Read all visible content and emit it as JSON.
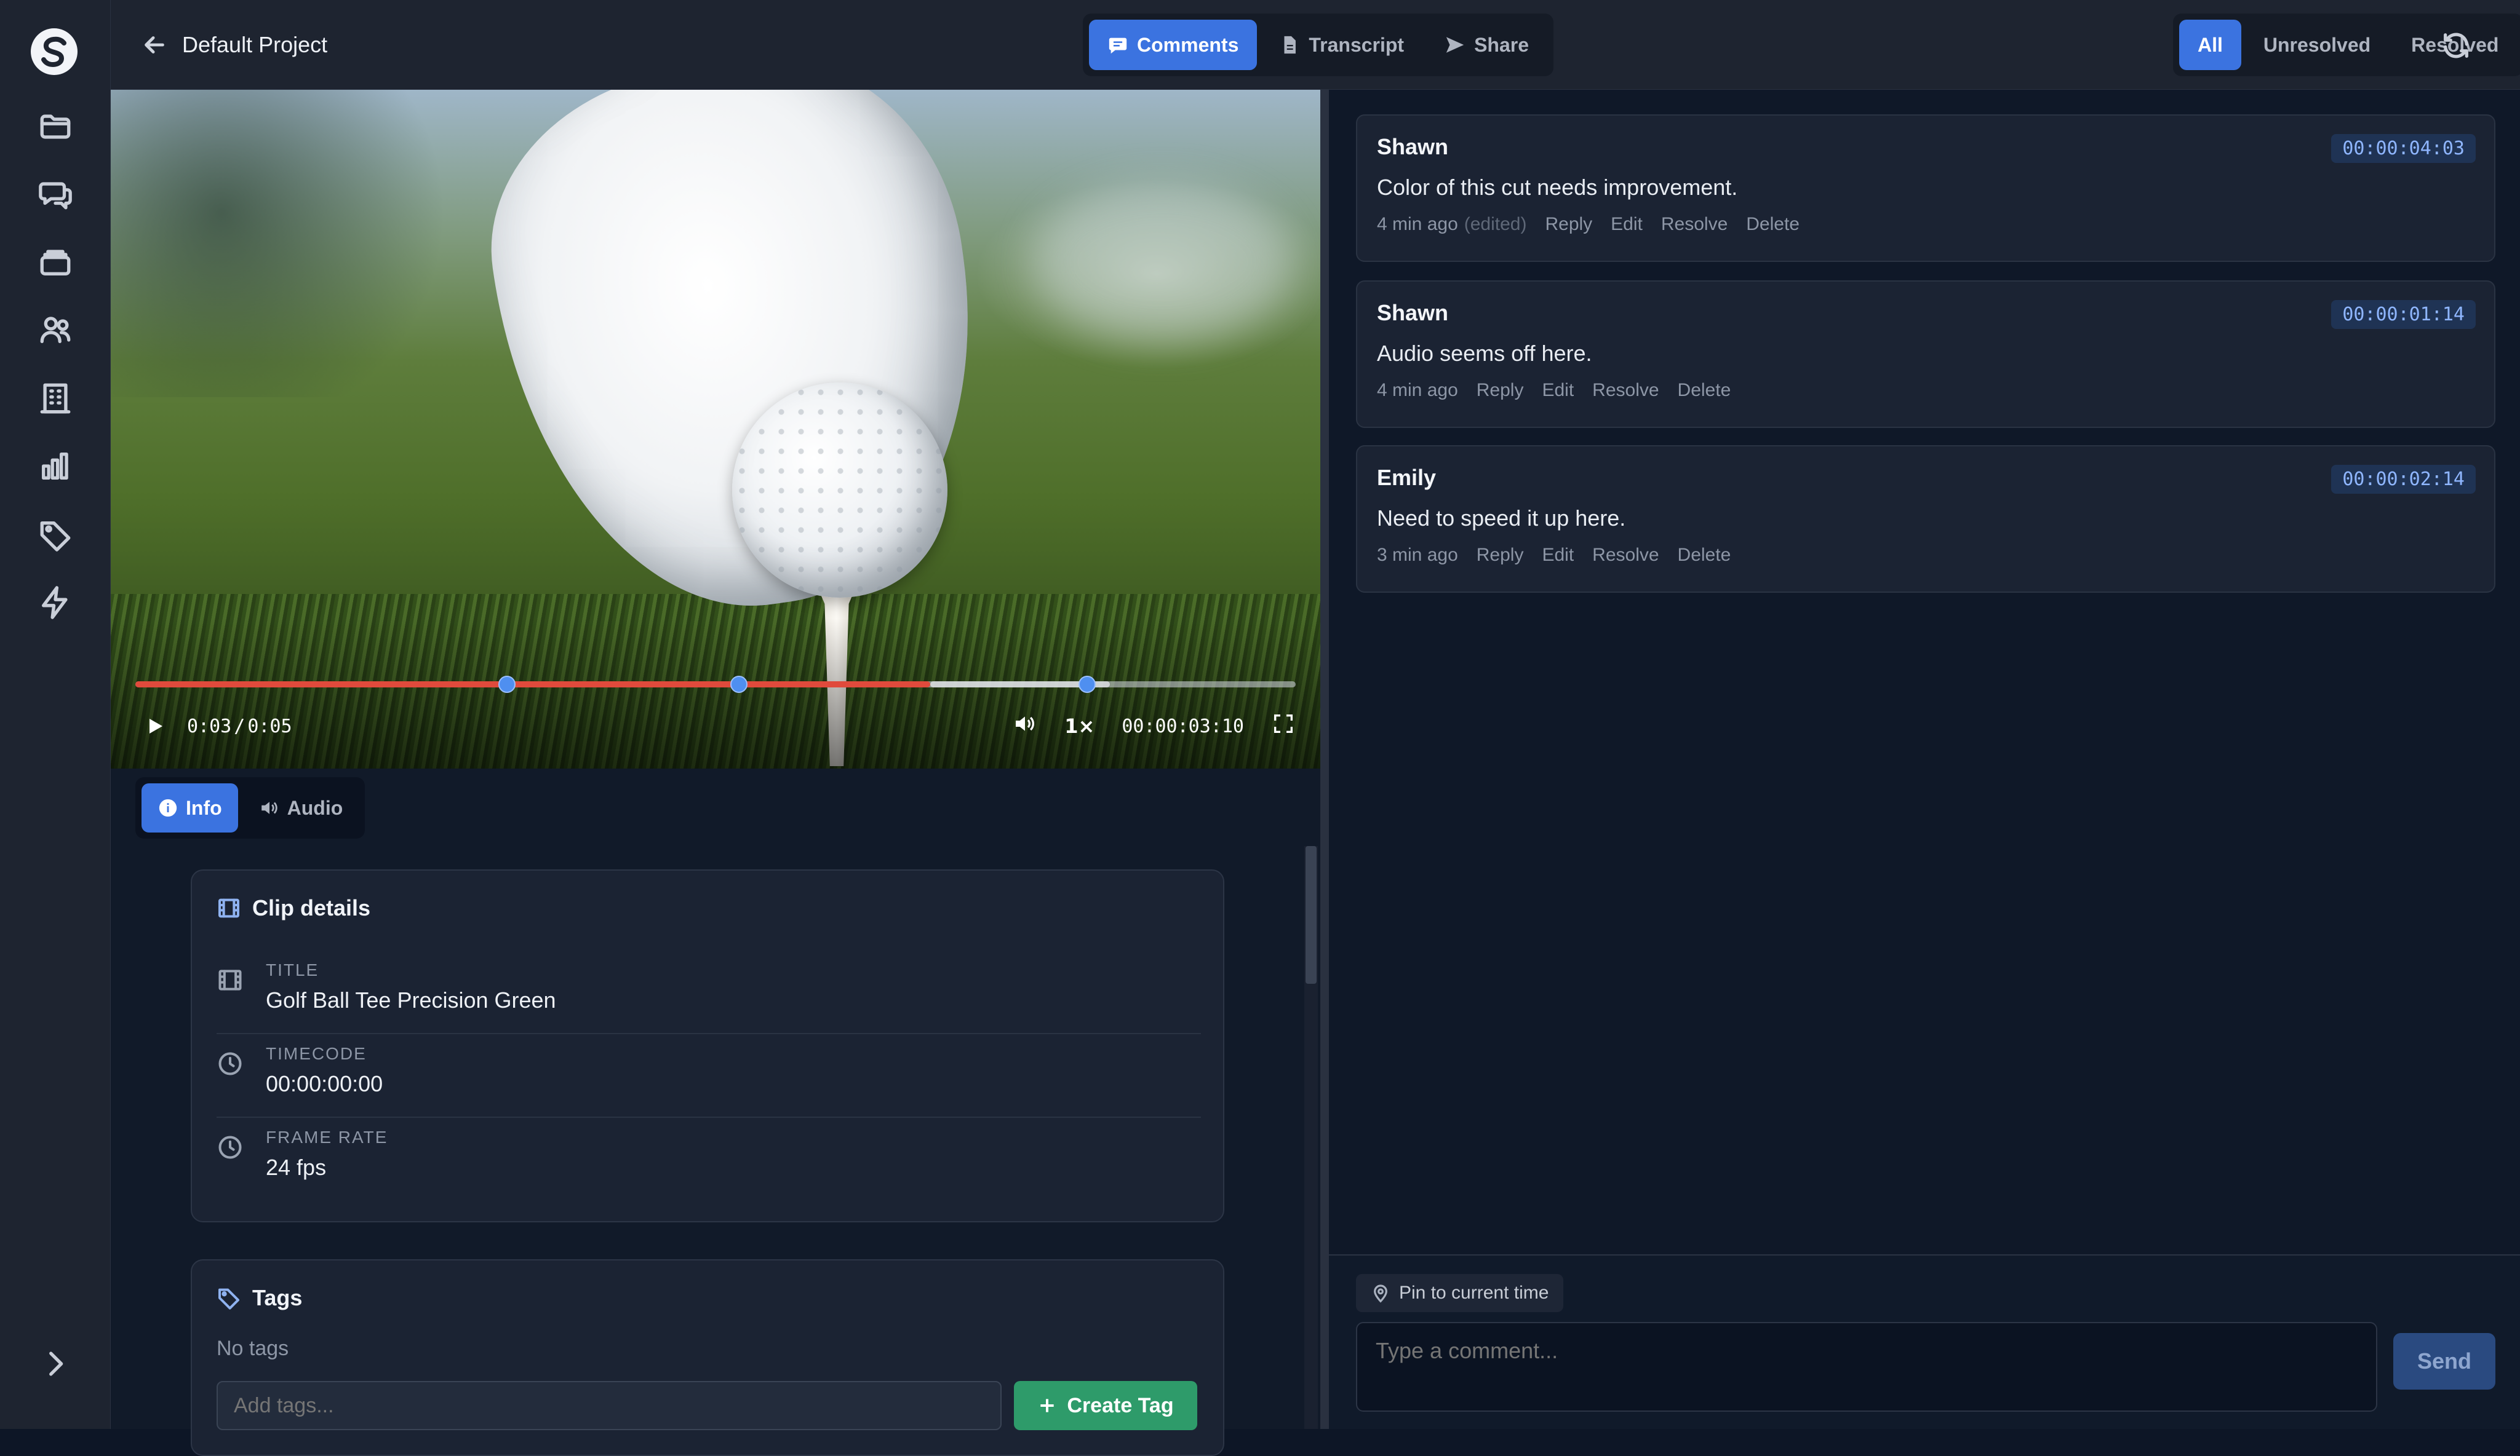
{
  "header": {
    "back_label": "Default Project",
    "view_tabs": [
      {
        "label": "Comments",
        "icon": "comment-icon",
        "active": true
      },
      {
        "label": "Transcript",
        "icon": "document-icon",
        "active": false
      },
      {
        "label": "Share",
        "icon": "send-icon",
        "active": false
      }
    ],
    "filter_tabs": [
      {
        "label": "All",
        "active": true
      },
      {
        "label": "Unresolved",
        "active": false
      },
      {
        "label": "Resolved",
        "active": false
      }
    ]
  },
  "sidebar": {
    "items": [
      "folder-icon",
      "chat-icon",
      "stack-icon",
      "users-icon",
      "building-icon",
      "bar-chart-icon",
      "tag-icon",
      "lightning-icon"
    ],
    "expand_icon": "chevron-right-icon"
  },
  "player": {
    "current_time": "0:03",
    "separator": "/",
    "duration": "0:05",
    "playback_rate": "1×",
    "timecode": "00:00:03:10",
    "progress_fraction": 0.685,
    "markers_fraction": [
      0.32,
      0.52,
      0.82
    ]
  },
  "info_tabs": [
    {
      "label": "Info",
      "icon": "info-icon",
      "active": true
    },
    {
      "label": "Audio",
      "icon": "speaker-icon",
      "active": false
    }
  ],
  "clip_details": {
    "title": "Clip details",
    "rows": [
      {
        "label": "TITLE",
        "value": "Golf Ball Tee Precision Green"
      },
      {
        "label": "TIMECODE",
        "value": "00:00:00:00"
      },
      {
        "label": "FRAME RATE",
        "value": "24 fps"
      }
    ]
  },
  "tags": {
    "title": "Tags",
    "empty_text": "No tags",
    "input_placeholder": "Add tags...",
    "create_label": "Create Tag"
  },
  "comments": [
    {
      "author": "Shawn",
      "timecode": "00:00:04:03",
      "text": "Color of this cut needs improvement.",
      "time_ago": "4 min ago",
      "edited": "(edited)",
      "actions": [
        "Reply",
        "Edit",
        "Resolve",
        "Delete"
      ]
    },
    {
      "author": "Shawn",
      "timecode": "00:00:01:14",
      "text": "Audio seems off here.",
      "time_ago": "4 min ago",
      "edited": "",
      "actions": [
        "Reply",
        "Edit",
        "Resolve",
        "Delete"
      ]
    },
    {
      "author": "Emily",
      "timecode": "00:00:02:14",
      "text": "Need to speed it up here.",
      "time_ago": "3 min ago",
      "edited": "",
      "actions": [
        "Reply",
        "Edit",
        "Resolve",
        "Delete"
      ]
    }
  ],
  "composer": {
    "pin_label": "Pin to current time",
    "placeholder": "Type a comment...",
    "send_label": "Send"
  },
  "colors": {
    "accent": "#3b73e0",
    "progress": "#e04a3c",
    "create_tag": "#2e9b6a",
    "background": "#0d1626"
  }
}
